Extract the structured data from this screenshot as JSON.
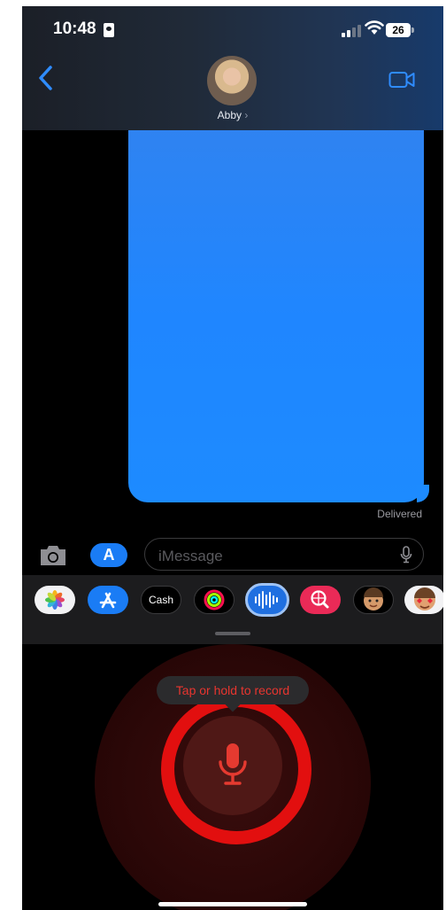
{
  "status_bar": {
    "time": "10:48",
    "battery_label": "26",
    "icons": [
      "contact-card-icon",
      "signal-icon",
      "wifi-icon",
      "battery-icon"
    ]
  },
  "header": {
    "back_icon": "chevron-left-icon",
    "contact_name": "Abby",
    "contact_chevron": "›",
    "video_icon": "video-camera-icon"
  },
  "conversation": {
    "status": "Delivered",
    "bubble_color": "#1f86ff"
  },
  "composer": {
    "camera_icon": "camera-icon",
    "apps_icon": "app-store-icon",
    "apps_glyph": "A",
    "placeholder": "iMessage",
    "mic_icon": "microphone-icon"
  },
  "app_drawer": {
    "apps": [
      {
        "name": "photos-icon"
      },
      {
        "name": "app-store-icon"
      },
      {
        "name": "apple-cash-icon",
        "label": "Cash"
      },
      {
        "name": "activity-icon"
      },
      {
        "name": "audio-message-icon"
      },
      {
        "name": "image-search-icon"
      },
      {
        "name": "memoji-icon"
      },
      {
        "name": "memoji-stickers-icon"
      }
    ]
  },
  "recorder": {
    "hint": "Tap or hold to record",
    "button_icon": "microphone-icon",
    "accent": "#e20f0f"
  }
}
